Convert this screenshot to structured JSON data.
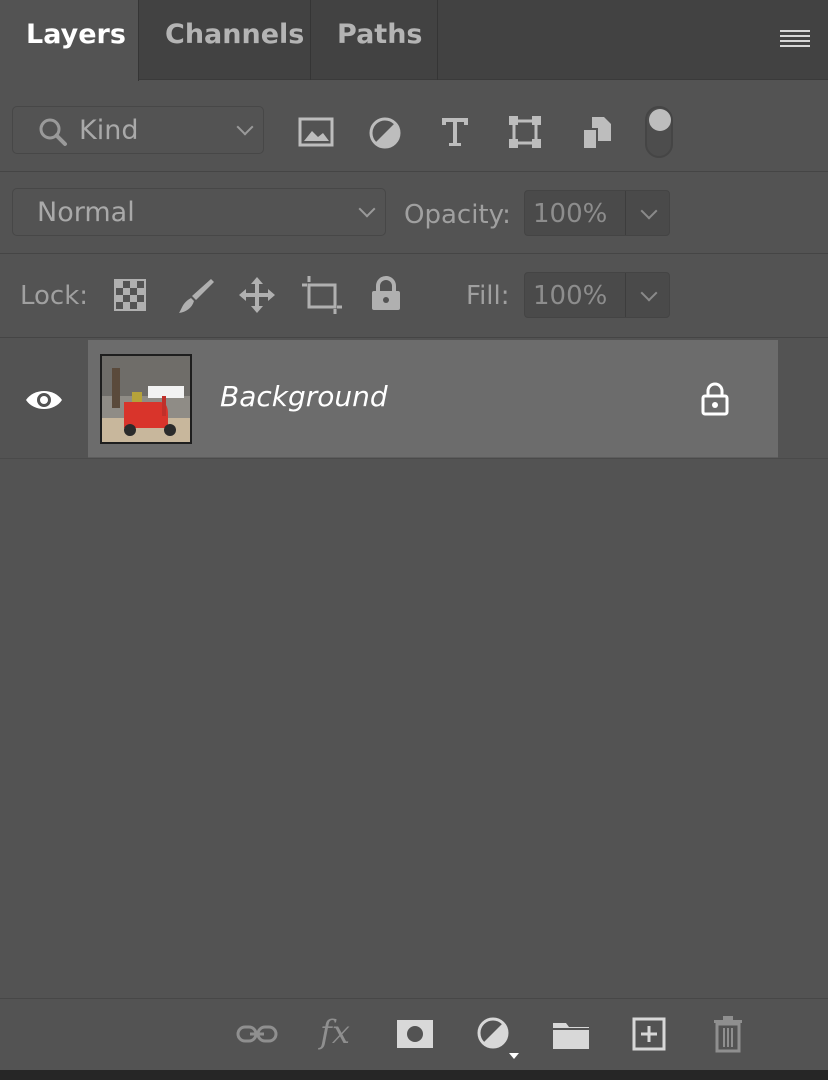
{
  "tabs": [
    {
      "label": "Layers",
      "active": true
    },
    {
      "label": "Channels",
      "active": false
    },
    {
      "label": "Paths",
      "active": false
    }
  ],
  "filter": {
    "kind_label": "Kind",
    "icons": [
      "image-filter-icon",
      "adjustment-filter-icon",
      "type-filter-icon",
      "shape-filter-icon",
      "smart-object-filter-icon"
    ]
  },
  "blend": {
    "mode": "Normal",
    "opacity_label": "Opacity:",
    "opacity_value": "100%"
  },
  "lock": {
    "label": "Lock:",
    "icons": [
      "lock-transparent-pixels-icon",
      "lock-image-pixels-icon",
      "lock-position-icon",
      "lock-artboard-icon",
      "lock-all-icon"
    ],
    "fill_label": "Fill:",
    "fill_value": "100%"
  },
  "layers": [
    {
      "name": "Background",
      "visible": true,
      "locked": true
    }
  ],
  "bottom_bar": {
    "fx_label": "fx",
    "icons": [
      "link-layers-icon",
      "layer-style-icon",
      "layer-mask-icon",
      "adjustment-layer-icon",
      "group-folder-icon",
      "new-layer-icon",
      "delete-layer-icon"
    ]
  },
  "colors": {
    "panel_bg": "#535353",
    "tab_bar_bg": "#424242",
    "selected_layer_bg": "#6c6c6c"
  }
}
